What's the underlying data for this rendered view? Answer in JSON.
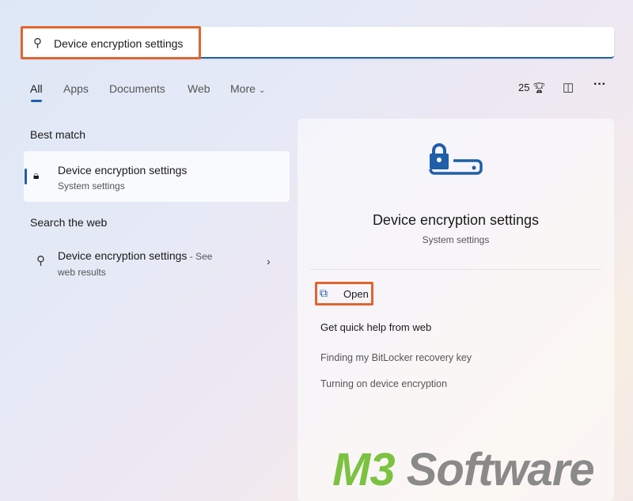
{
  "search": {
    "query": "Device encryption settings",
    "icon": "search-icon"
  },
  "tabs": [
    {
      "label": "All"
    },
    {
      "label": "Apps"
    },
    {
      "label": "Documents"
    },
    {
      "label": "Web"
    },
    {
      "label": "More"
    }
  ],
  "toolbar": {
    "points": "25",
    "points_icon": "trophy-icon",
    "account_icon": "account-switch-icon",
    "more_icon": "ellipsis-icon"
  },
  "best_match": {
    "header": "Best match",
    "title": "Device encryption settings",
    "subtitle": "System settings"
  },
  "web": {
    "header": "Search the web",
    "title": "Device encryption settings",
    "suffix": " - See",
    "subtitle": "web results"
  },
  "preview": {
    "title": "Device encryption settings",
    "subtitle": "System settings",
    "open_label": "Open",
    "help_header": "Get quick help from web",
    "links": [
      "Finding my BitLocker recovery key",
      "Turning on device encryption"
    ]
  },
  "watermark": {
    "m3": "M3",
    "software": "Software"
  },
  "colors": {
    "accent": "#1f5fa8",
    "highlight": "#e0652e",
    "watermark_green": "#7cc241",
    "watermark_gray": "#8a8a8a"
  }
}
